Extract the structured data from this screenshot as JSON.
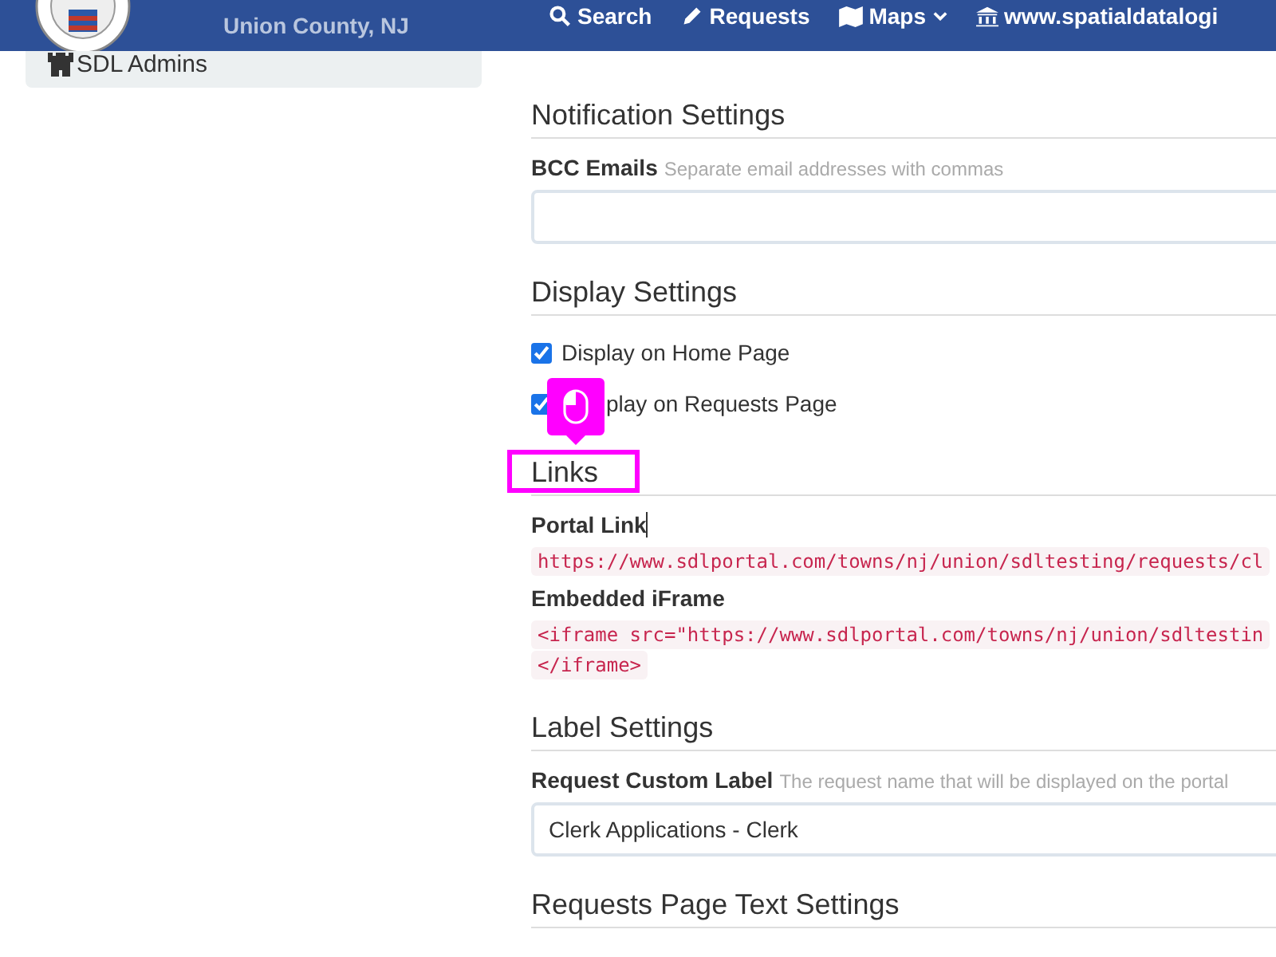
{
  "header": {
    "subtitle": "Union County, NJ",
    "nav": [
      {
        "kind": "search",
        "label": "Search"
      },
      {
        "kind": "requests",
        "label": "Requests"
      },
      {
        "kind": "maps",
        "label": "Maps"
      },
      {
        "kind": "site",
        "label": "www.spatialdatalogi"
      }
    ]
  },
  "sidebar": {
    "items": [
      {
        "label": "SDL Admins"
      }
    ]
  },
  "sections": [
    {
      "title": "Notification Settings",
      "fields": [
        {
          "kind": "input",
          "label": "BCC Emails",
          "hint": "Separate email addresses with commas"
        }
      ]
    },
    {
      "title": "Display Settings",
      "fields": [
        {
          "kind": "checkbox",
          "label": "Display on Home Page",
          "checked": true
        },
        {
          "kind": "checkbox",
          "label": "play on Requests Page",
          "checked": true
        }
      ]
    },
    {
      "title": "Links",
      "highlighted": true,
      "fields": [
        {
          "kind": "code",
          "label": "Portal Link",
          "lines": [
            "https://www.sdlportal.com/towns/nj/union/sdltesting/requests/cl"
          ]
        },
        {
          "kind": "code",
          "label": "Embedded iFrame",
          "lines": [
            "<iframe src=\"https://www.sdlportal.com/towns/nj/union/sdltestin",
            "</iframe>"
          ]
        }
      ]
    },
    {
      "title": "Label Settings",
      "fields": [
        {
          "kind": "input",
          "label": "Request Custom Label",
          "hint": "The request name that will be displayed on the portal",
          "value": "Clerk Applications - Clerk"
        }
      ]
    },
    {
      "title": "Requests Page Text Settings"
    }
  ]
}
